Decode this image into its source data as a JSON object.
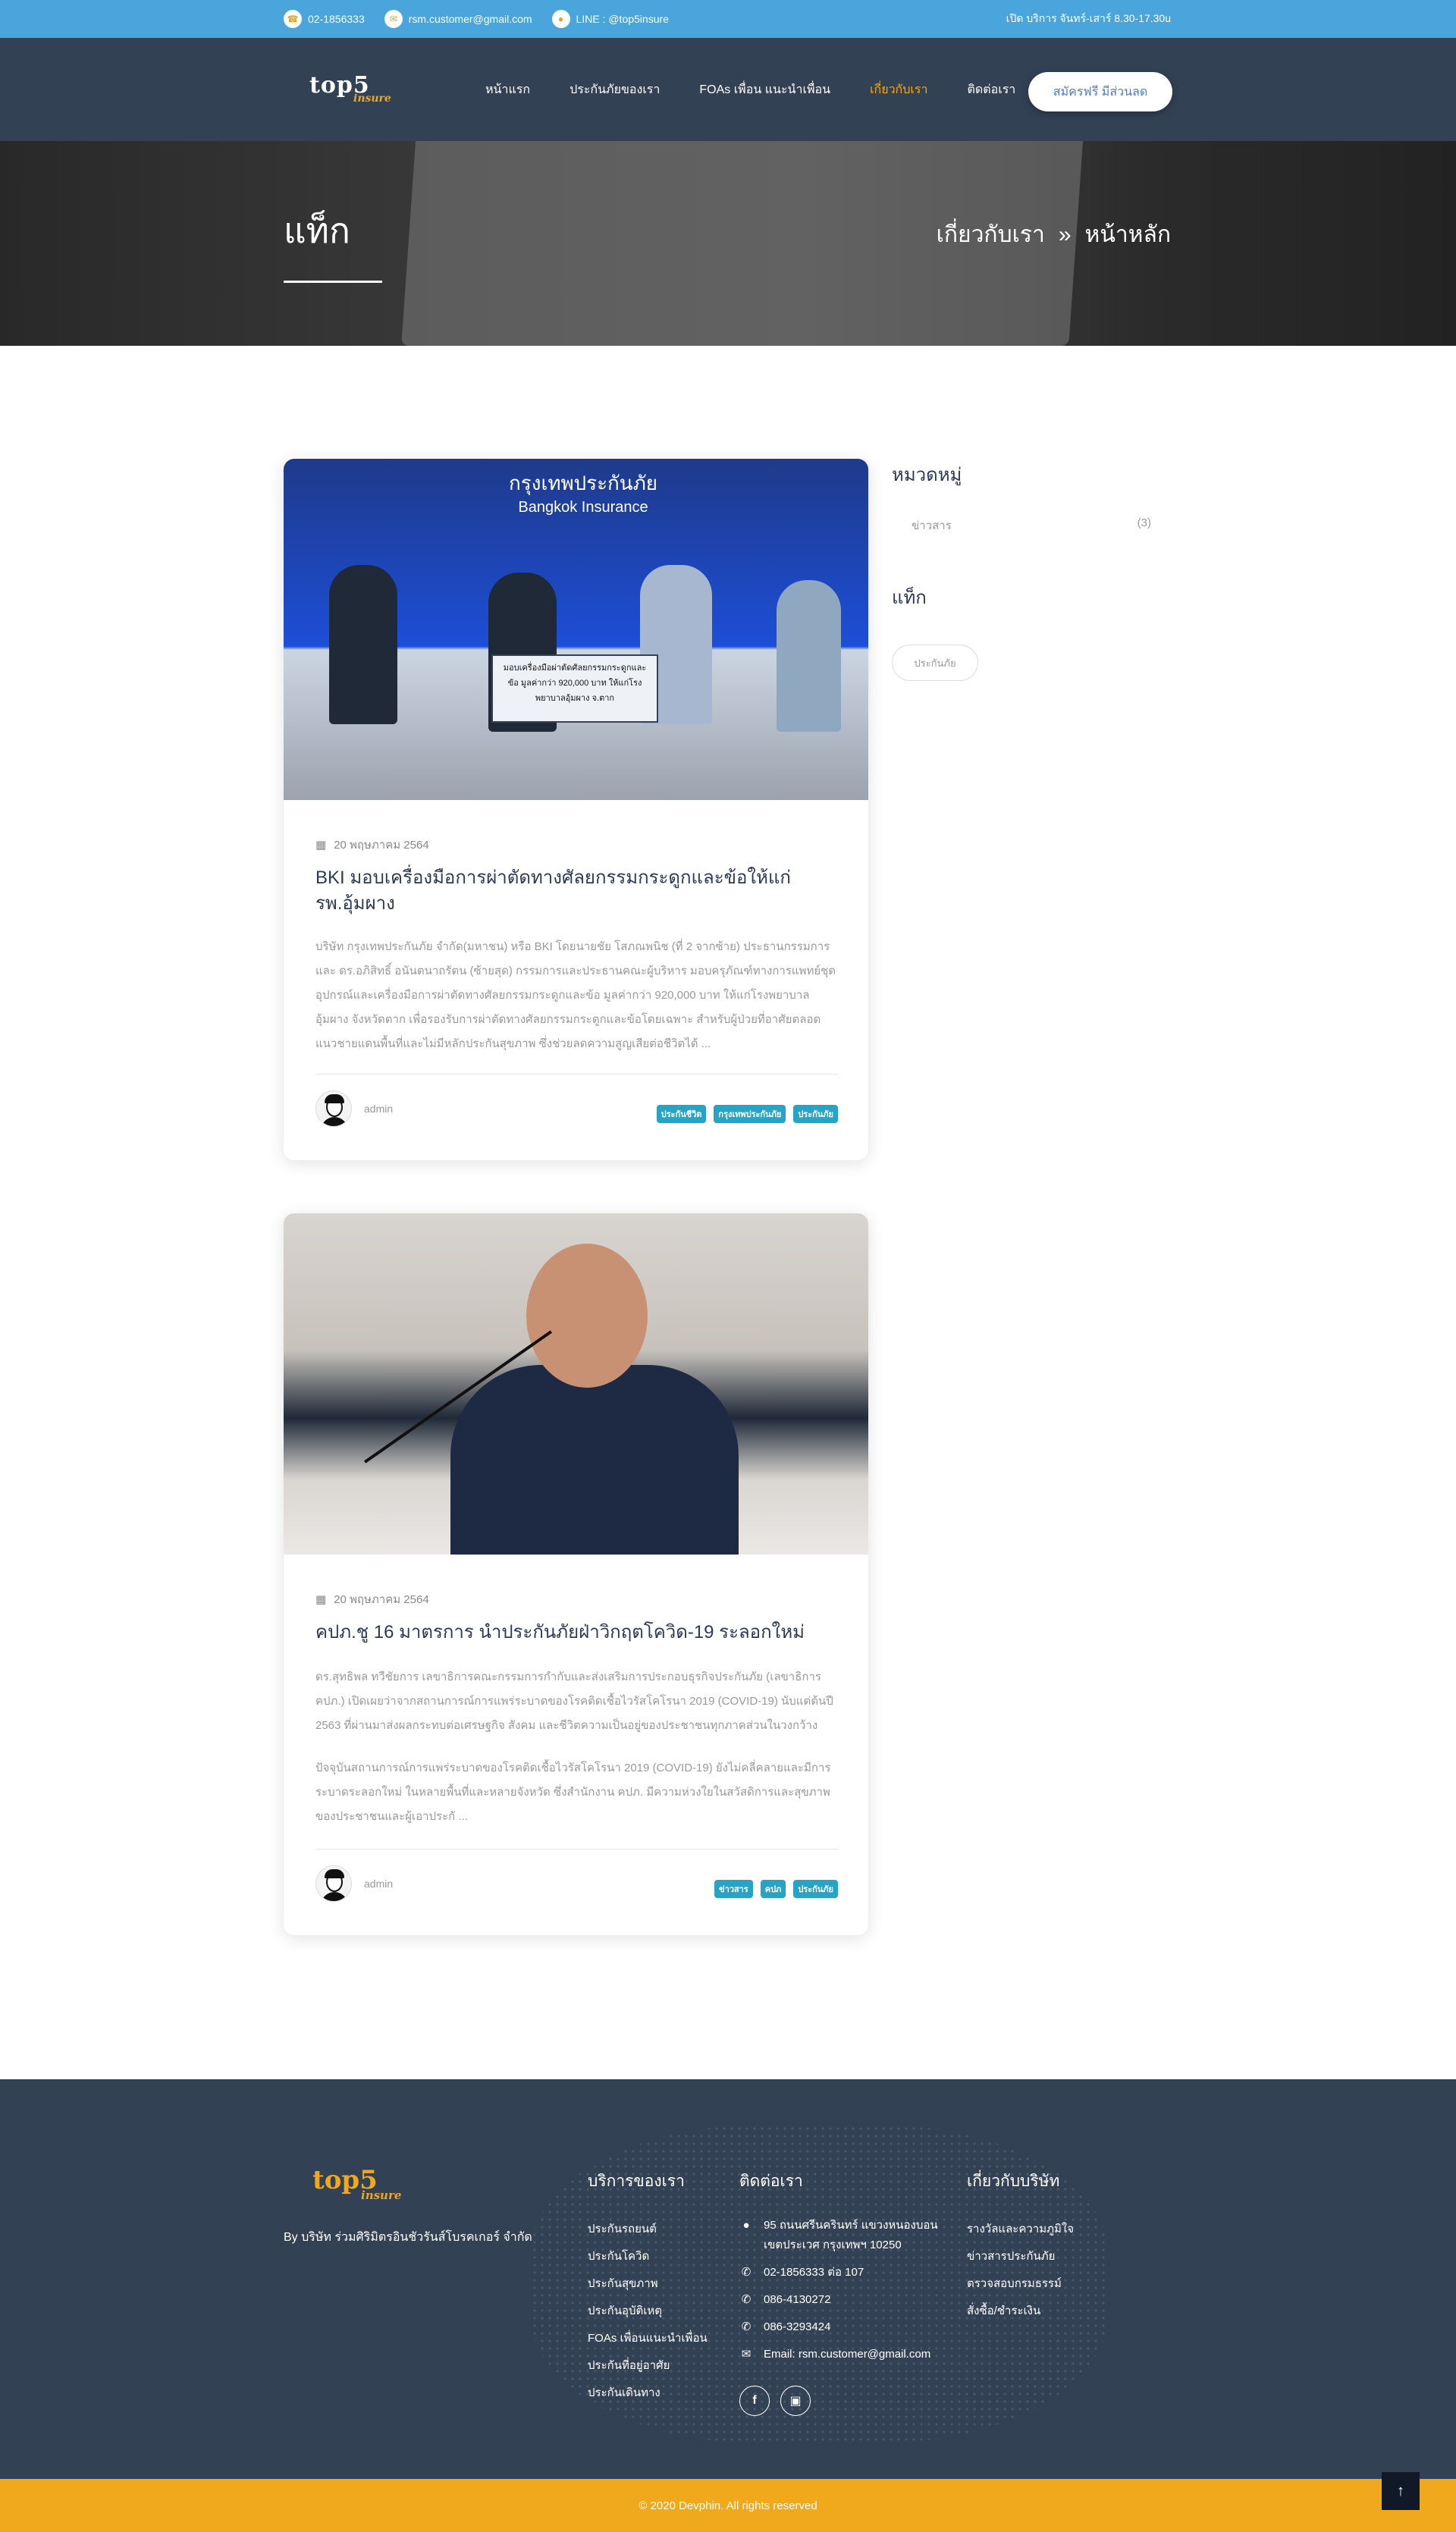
{
  "topbar": {
    "phone": "02-1856333",
    "email": "rsm.customer@gmail.com",
    "line": "LINE : @top5insure",
    "hours": "เปิด บริการ จันทร์-เสาร์ 8.30-17.30u"
  },
  "nav": {
    "logo_top": "top5",
    "logo_bottom": "insure",
    "items": [
      "หน้าแรก",
      "ประกันภัยของเรา",
      "FOAs เพื่อน แนะนำเพื่อน",
      "เกี่ยวกับเรา",
      "ติดต่อเรา"
    ],
    "active_index": 3,
    "cta": "สมัครฟรี มีส่วนลด"
  },
  "hero": {
    "title": "แท็ก",
    "breadcrumb_current": "เกี่ยวกับเรา",
    "breadcrumb_sep": "»",
    "breadcrumb_home": "หน้าหลัก"
  },
  "posts": [
    {
      "date": "20 พฤษภาคม 2564",
      "title": "BKI มอบเครื่องมือการผ่าตัดทางศัลยกรรมกระดูกและข้อให้แก่ รพ.อุ้มผาง",
      "excerpt": "บริษัท กรุงเทพประกันภัย จำกัด(มหาชน) หรือ BKI โดยนายชัย โสภณพนิช (ที่ 2 จากซ้าย) ประธานกรรมการ และ ดร.อภิสิทธิ์ อนันตนาถรัตน (ซ้ายสุด) กรรมการและประธานคณะผู้บริหาร มอบครุภัณฑ์ทางการแพทย์ชุดอุปกรณ์และเครื่องมือการผ่าตัดทางศัลยกรรมกระดูกและข้อ มูลค่ากว่า 920,000 บาท ให้แก่โรงพยาบาลอุ้มผาง จังหวัดตาก เพื่อรองรับการผ่าตัดทางศัลยกรรมกระดูกและข้อโดยเฉพาะ สำหรับผู้ป่วยที่อาศัยตลอดแนวชายแดนพื้นที่และไม่มีหลักประกันสุขภาพ ซึ่งช่วยลดความสูญเสียต่อชีวิตได้ ...",
      "author": "admin",
      "tags": [
        "ประกันชีวิต",
        "กรุงเทพประกันภัย",
        "ประกันภัย"
      ],
      "photo_heading": "กรุงเทพประกันภัย",
      "photo_subheading": "Bangkok Insurance",
      "photo_sign": "มอบเครื่องมือผ่าตัดศัลยกรรมกระดูกและข้อ มูลค่ากว่า 920,000 บาท ให้แก่โรงพยาบาลอุ้มผาง จ.ตาก"
    },
    {
      "date": "20 พฤษภาคม 2564",
      "title": "คปภ.ชู 16 มาตรการ นำประกันภัยฝ่าวิกฤตโควิด-19 ระลอกใหม่",
      "excerpt": "ดร.สุทธิพล ทวีชัยการ เลขาธิการคณะกรรมการกำกับและส่งเสริมการประกอบธุรกิจประกันภัย (เลขาธิการ คปภ.) เปิดเผยว่าจากสถานการณ์การแพร่ระบาดของโรคติดเชื้อไวรัสโคโรนา 2019 (COVID-19) นับแต่ต้นปี 2563 ที่ผ่านมาส่งผลกระทบต่อเศรษฐกิจ สังคม และชีวิตความเป็นอยู่ของประชาชนทุกภาคส่วนในวงกว้าง",
      "excerpt2": "ปัจจุบันสถานการณ์การแพร่ระบาดของโรคติดเชื้อไวรัสโคโรนา 2019 (COVID-19) ยังไม่คลี่คลายและมีการระบาดระลอกใหม่ ในหลายพื้นที่และหลายจังหวัด ซึ่งสำนักงาน คปภ. มีความห่วงใยในสวัสดิการและสุขภาพของประชาชนและผู้เอาประกั ...",
      "author": "admin",
      "tags": [
        "ข่าวสาร",
        "คปภ",
        "ประกันภัย"
      ]
    }
  ],
  "sidebar": {
    "categories_title": "หมวดหมู่",
    "categories": [
      {
        "name": "ข่าวสาร",
        "count": "(3)"
      }
    ],
    "tags_title": "แท็ก",
    "tags": [
      "ประกันภัย"
    ]
  },
  "footer": {
    "logo_top": "top5",
    "logo_bottom": "insure",
    "company": "By บริษัท ร่วมศิริมิตรอินชัวรันส์โบรคเกอร์ จำกัด",
    "services_title": "บริการของเรา",
    "services": [
      "ประกันรถยนต์",
      "ประกันโควิด",
      "ประกันสุขภาพ",
      "ประกันอุบัติเหตุ",
      "FOAs เพื่อนแนะนำเพื่อน",
      "ประกันที่อยู่อาศัย",
      "ประกันเดินทาง"
    ],
    "contact_title": "ติดต่อเรา",
    "address": "95 ถนนศรีนครินทร์ แขวงหนองบอน เขตประเวศ กรุงเทพฯ 10250",
    "phone1": "02-1856333 ต่อ 107",
    "phone2": "086-4130272",
    "phone3": "086-3293424",
    "email": "Email: rsm.customer@gmail.com",
    "about_title": "เกี่ยวกับบริษัท",
    "about": [
      "รางวัลและความภูมิใจ",
      "ข่าวสารประกันภัย",
      "ตรวจสอบกรมธรรม์",
      "สั่งซื้อ/ชำระเงิน"
    ],
    "copyright": "© 2020 Devphin. All rights reserved"
  }
}
